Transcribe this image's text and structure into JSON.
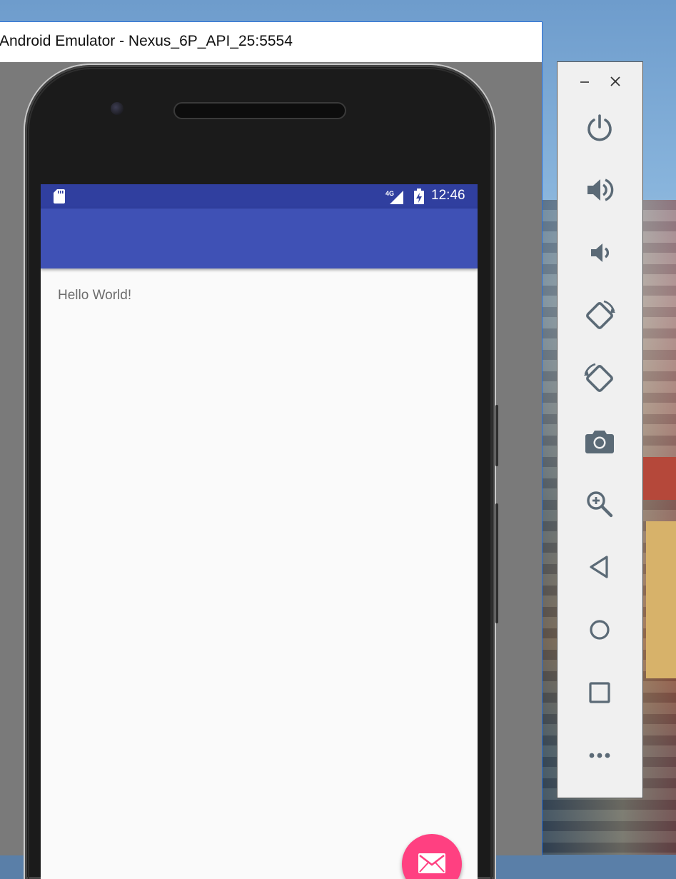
{
  "window": {
    "title": "Android Emulator - Nexus_6P_API_25:5554"
  },
  "statusbar": {
    "network": "4G",
    "time": "12:46"
  },
  "app": {
    "content_text": "Hello World!",
    "fab_icon": "email-icon",
    "colors": {
      "status_bar": "#303f9f",
      "app_bar": "#3f51b5",
      "fab": "#ff4081"
    }
  },
  "toolbar": {
    "controls": [
      "minimize-icon",
      "close-icon"
    ],
    "buttons": [
      "power-icon",
      "volume-up-icon",
      "volume-down-icon",
      "rotate-left-icon",
      "rotate-right-icon",
      "camera-icon",
      "zoom-icon",
      "back-icon",
      "home-icon",
      "overview-icon",
      "more-icon"
    ],
    "icon_color": "#5b6a76"
  }
}
